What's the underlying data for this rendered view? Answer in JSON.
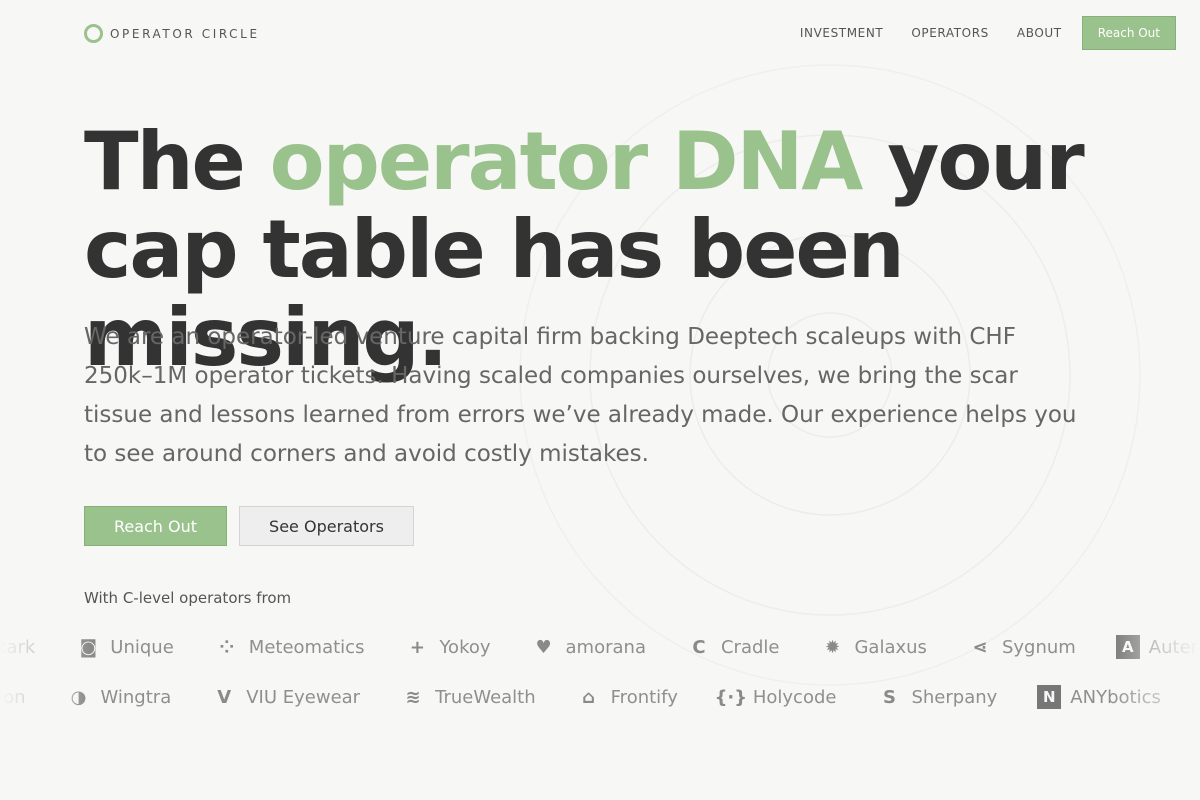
{
  "brand": {
    "name": "OPERATOR CIRCLE",
    "accent": "#9ac28c"
  },
  "nav": {
    "links": [
      "INVESTMENT",
      "OPERATORS",
      "ABOUT"
    ],
    "cta": "Reach Out"
  },
  "hero": {
    "title_pre": "The ",
    "title_accent": "operator DNA",
    "title_post": " your cap table has been missing.",
    "lede": "We are an operator-led venture capital firm backing Deeptech scaleups with CHF 250k–1M operator tickets. Having scaled companies ourselves, we bring the scar tissue and lessons learned from errors we’ve already made. Our experience helps you to see around corners and avoid costly mistakes.",
    "primary_button": "Reach Out",
    "secondary_button": "See Operators"
  },
  "companies": {
    "label": "With C-level operators from",
    "row1": [
      {
        "name": "stark",
        "icon": "stark-icon"
      },
      {
        "name": "Unique",
        "icon": "unique-icon"
      },
      {
        "name": "Meteomatics",
        "icon": "meteomatics-icon"
      },
      {
        "name": "Yokoy",
        "icon": "yokoy-icon"
      },
      {
        "name": "amorana",
        "icon": "amorana-icon"
      },
      {
        "name": "Cradle",
        "icon": "cradle-icon"
      },
      {
        "name": "Galaxus",
        "icon": "galaxus-icon"
      },
      {
        "name": "Sygnum",
        "icon": "sygnum-icon"
      },
      {
        "name": "Auterion",
        "icon": "auterion-icon"
      }
    ],
    "row2": [
      {
        "name": "otion",
        "icon": "otion-icon"
      },
      {
        "name": "Wingtra",
        "icon": "wingtra-icon"
      },
      {
        "name": "VIU Eyewear",
        "icon": "viu-icon"
      },
      {
        "name": "TrueWealth",
        "icon": "truewealth-icon"
      },
      {
        "name": "Frontify",
        "icon": "frontify-icon"
      },
      {
        "name": "Holycode",
        "icon": "holycode-icon"
      },
      {
        "name": "Sherpany",
        "icon": "sherpany-icon"
      },
      {
        "name": "ANYbotics",
        "icon": "anybotics-icon"
      },
      {
        "name": "",
        "icon": "partial-logo-icon"
      }
    ]
  }
}
